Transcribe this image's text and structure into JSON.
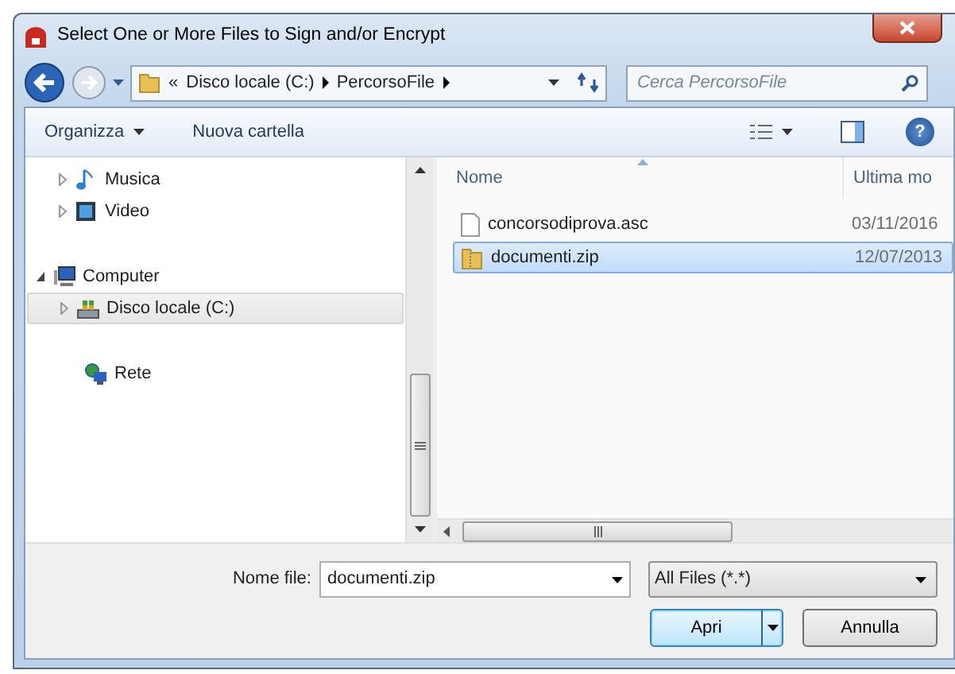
{
  "window": {
    "title": "Select One or More Files to Sign and/or Encrypt"
  },
  "address_bar": {
    "overflow": "«",
    "segments": [
      "Disco locale (C:)",
      "PercorsoFile"
    ]
  },
  "search": {
    "placeholder": "Cerca PercorsoFile"
  },
  "toolbar": {
    "buttons": [
      {
        "label": "Organizza",
        "has_menu": true
      },
      {
        "label": "Nuova cartella",
        "has_menu": false
      }
    ],
    "help": "?"
  },
  "nav_pane": {
    "scrolled_items": [
      {
        "label": "Musica",
        "kind": "music",
        "expanded": false,
        "selected": false
      },
      {
        "label": "Video",
        "kind": "video",
        "expanded": false,
        "selected": false
      }
    ],
    "items": [
      {
        "label": "Computer",
        "kind": "computer",
        "expanded": true,
        "selected": false,
        "children": [
          {
            "label": "Disco locale (C:)",
            "kind": "drive",
            "expanded": false,
            "selected": true
          }
        ]
      },
      {
        "label": "Rete",
        "kind": "network",
        "selected": false
      }
    ]
  },
  "file_list": {
    "columns": [
      {
        "label": "Nome",
        "sorted": true
      },
      {
        "label": "Ultima mo",
        "sorted": false
      }
    ],
    "rows": [
      {
        "name": "concorsodiprova.asc",
        "date": "03/11/2016",
        "kind": "file",
        "selected": false
      },
      {
        "name": "documenti.zip",
        "date": "12/07/2013",
        "kind": "zip",
        "selected": true
      }
    ]
  },
  "footer": {
    "filename_label": "Nome file:",
    "filename": "documenti.zip",
    "filter": "All Files (*.*)",
    "buttons": [
      {
        "label": "Apri",
        "default": true,
        "split": true
      },
      {
        "label": "Annulla",
        "default": false,
        "split": false
      }
    ]
  }
}
